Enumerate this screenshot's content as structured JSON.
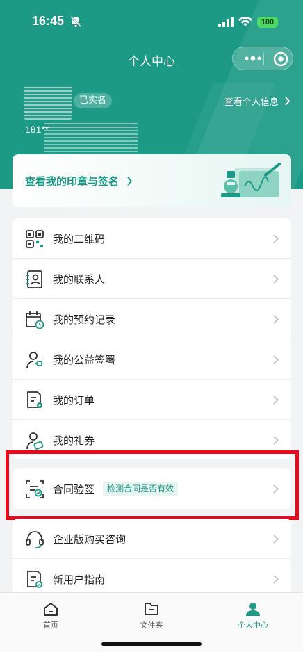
{
  "status": {
    "time": "16:45",
    "battery": "100"
  },
  "nav": {
    "title": "个人中心"
  },
  "profile": {
    "verified_badge": "已实名",
    "phone_partial": "181**",
    "view_info": "查看个人信息"
  },
  "seal_card": {
    "label": "查看我的印章与签名"
  },
  "menu": {
    "items": [
      {
        "label": "我的二维码",
        "icon": "qrcode-icon"
      },
      {
        "label": "我的联系人",
        "icon": "contacts-icon"
      },
      {
        "label": "我的预约记录",
        "icon": "calendar-icon"
      },
      {
        "label": "我的公益签署",
        "icon": "charity-icon"
      },
      {
        "label": "我的订单",
        "icon": "order-icon"
      },
      {
        "label": "我的礼券",
        "icon": "coupon-icon"
      }
    ]
  },
  "verify": {
    "label": "合同验签",
    "tag": "检测合同是否有效"
  },
  "extra": {
    "items": [
      {
        "label": "企业版购买咨询",
        "icon": "headset-icon"
      },
      {
        "label": "新用户指南",
        "icon": "guide-icon"
      }
    ]
  },
  "tabs": [
    {
      "label": "首页",
      "icon": "home-icon"
    },
    {
      "label": "文件夹",
      "icon": "folder-icon"
    },
    {
      "label": "个人中心",
      "icon": "user-icon"
    }
  ],
  "colors": {
    "brand": "#1d9a86",
    "highlight": "#e8091a"
  }
}
